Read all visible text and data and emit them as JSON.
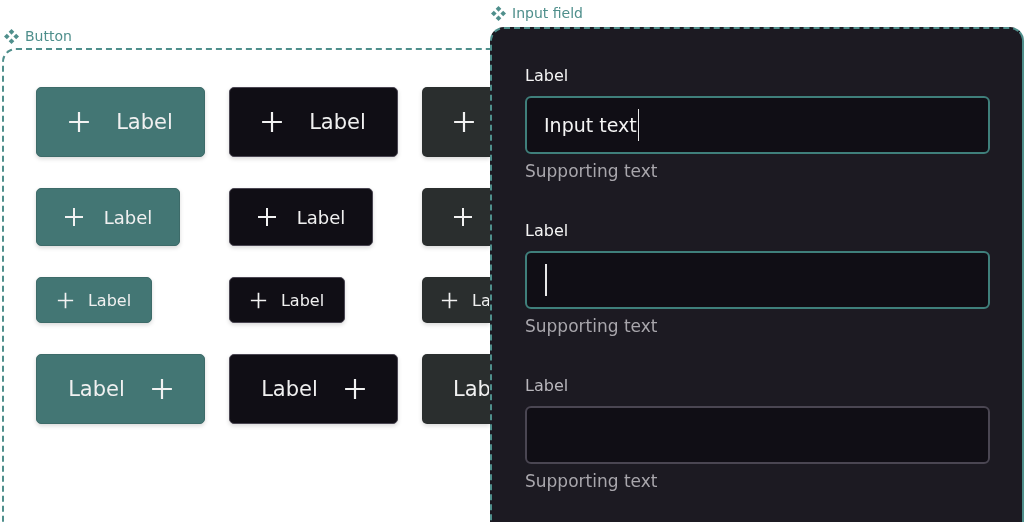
{
  "button_section": {
    "title": "Button",
    "rows": [
      [
        {
          "label": "Label"
        },
        {
          "label": "Label"
        },
        {}
      ],
      [
        {
          "label": "Label"
        },
        {
          "label": "Label"
        },
        {}
      ],
      [
        {
          "label": "Label"
        },
        {
          "label": "Label"
        },
        {
          "label": "La"
        }
      ],
      [
        {
          "label": "Label"
        },
        {
          "label": "Label"
        },
        {
          "label": "Lab"
        }
      ]
    ]
  },
  "input_section": {
    "title": "Input field",
    "fields": [
      {
        "label": "Label",
        "value": "Input text",
        "focused": true,
        "supporting_text": "Supporting text"
      },
      {
        "label": "Label",
        "focused": true,
        "supporting_text": "Supporting text"
      },
      {
        "label": "Label",
        "focused": false,
        "supporting_text": "Supporting text"
      }
    ]
  }
}
